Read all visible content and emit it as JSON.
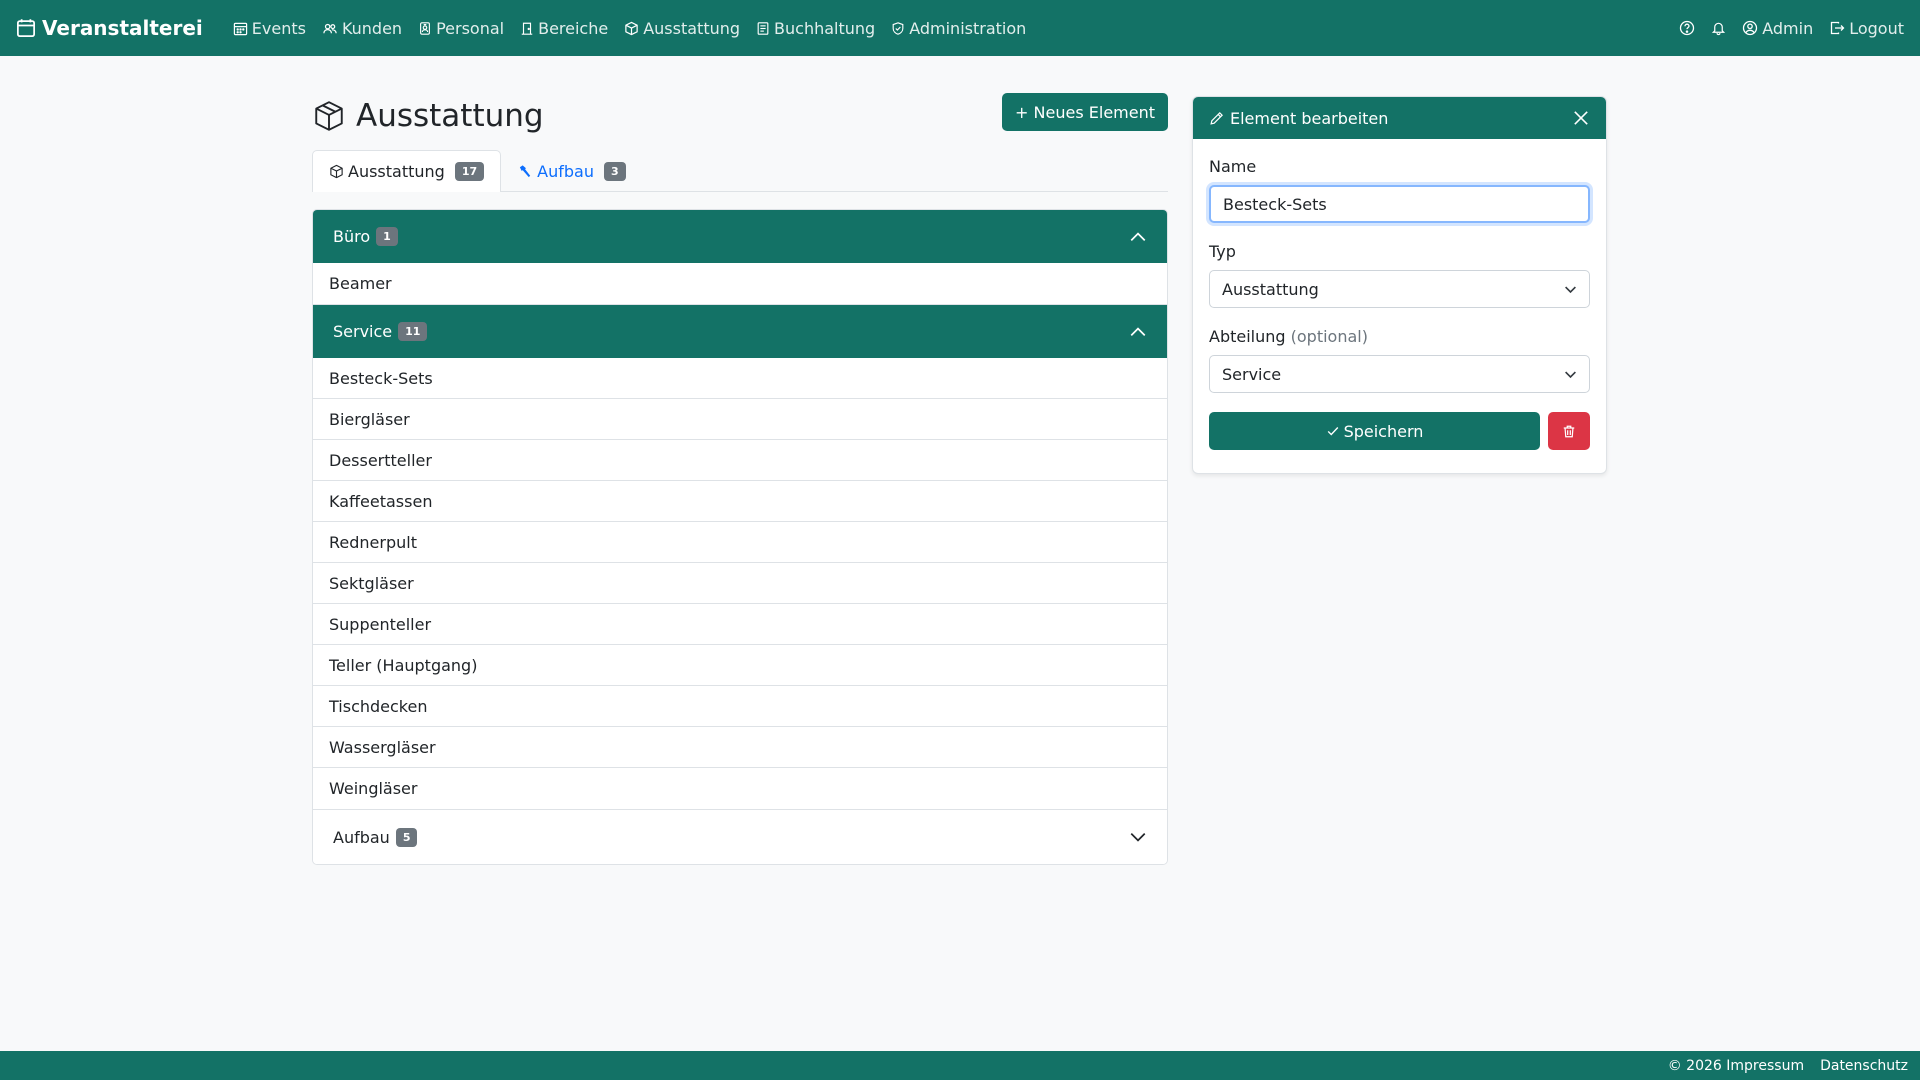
{
  "colors": {
    "brand": "#137266",
    "danger": "#dc3545",
    "link": "#0d6efd",
    "badge": "#6c757d"
  },
  "navbar": {
    "brand": "Veranstalterei",
    "items": [
      {
        "label": "Events",
        "icon": "calendar-icon"
      },
      {
        "label": "Kunden",
        "icon": "people-icon"
      },
      {
        "label": "Personal",
        "icon": "person-badge-icon"
      },
      {
        "label": "Bereiche",
        "icon": "door-icon"
      },
      {
        "label": "Ausstattung",
        "icon": "box-icon"
      },
      {
        "label": "Buchhaltung",
        "icon": "ledger-icon"
      },
      {
        "label": "Administration",
        "icon": "shield-icon"
      }
    ],
    "user": "Admin",
    "logout": "Logout"
  },
  "page": {
    "title": "Ausstattung",
    "new_button": "+ Neues Element"
  },
  "tabs": [
    {
      "label": "Ausstattung",
      "count": "17"
    },
    {
      "label": "Aufbau",
      "count": "3"
    }
  ],
  "groups": [
    {
      "name": "Büro",
      "count": "1",
      "items": [
        "Beamer"
      ]
    },
    {
      "name": "Service",
      "count": "11",
      "items": [
        "Besteck-Sets",
        "Biergläser",
        "Dessertteller",
        "Kaffeetassen",
        "Rednerpult",
        "Sektgläser",
        "Suppenteller",
        "Teller (Hauptgang)",
        "Tischdecken",
        "Wassergläser",
        "Weingläser"
      ]
    },
    {
      "name": "Aufbau",
      "count": "5",
      "items": []
    }
  ],
  "edit_panel": {
    "title": "Element bearbeiten",
    "name_label": "Name",
    "name_value": "Besteck-Sets",
    "type_label": "Typ",
    "type_value": "Ausstattung",
    "dept_label": "Abteilung",
    "dept_optional": "(optional)",
    "dept_value": "Service",
    "save_label": "Speichern"
  },
  "footer": {
    "impressum": "© 2026 Impressum",
    "datenschutz": "Datenschutz"
  }
}
